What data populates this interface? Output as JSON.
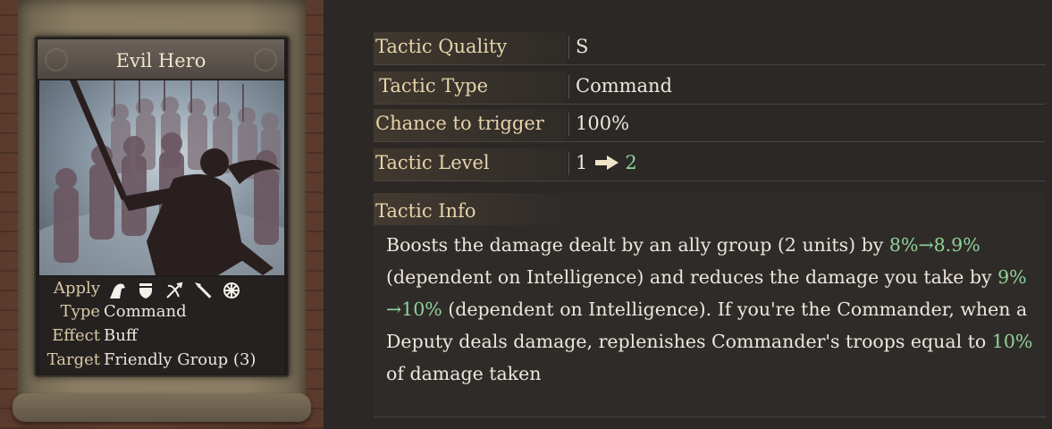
{
  "card": {
    "title": "Evil Hero",
    "apply_label": "Apply",
    "apply_icons": [
      "horse-icon",
      "shield-icon",
      "crossbow-icon",
      "spear-icon",
      "wheel-icon"
    ],
    "type_label": "Type",
    "type_value": "Command",
    "effect_label": "Effect",
    "effect_value": "Buff",
    "target_label": "Target",
    "target_value": "Friendly Group (3)"
  },
  "details": {
    "quality_label": "Tactic Quality",
    "quality_value": "S",
    "type_label": "Tactic Type",
    "type_value": "Command",
    "chance_label": "Chance to trigger",
    "chance_value": "100%",
    "level_label": "Tactic Level",
    "level_from": "1",
    "level_to": "2"
  },
  "info": {
    "title": "Tactic Info",
    "p1": "Boosts the damage dealt by an ally group (2 units) by ",
    "g1": "8%→8.9%",
    "p2": " (dependent on Intelligence) and reduces the damage you take by ",
    "g2": "9% →10%",
    "p3": " (dependent on Intelligence). If you're the Commander, when a Deputy deals damage, replenishes Commander's troops equal to ",
    "g3": "10%",
    "p4": " of damage taken"
  },
  "colors": {
    "highlight_green": "#8fd39a",
    "label_gold": "#e6d3aa"
  }
}
